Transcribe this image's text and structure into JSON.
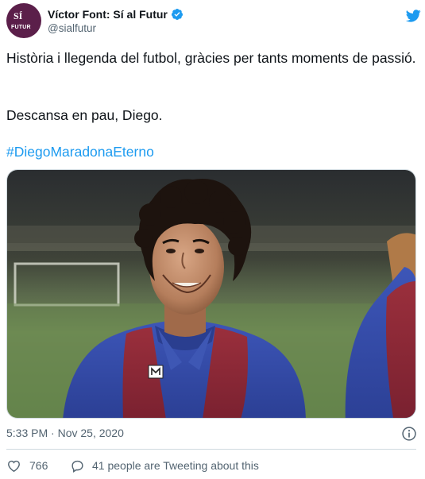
{
  "author": {
    "display_name": "Víctor Font: Sí al Futur",
    "handle": "@sialfutur",
    "avatar_text_top": "SÍ",
    "avatar_text_bottom": "FUTUR",
    "avatar_color": "#5b1f4a",
    "verified": true
  },
  "tweet": {
    "line1": "Història i llegenda del futbol, gràcies per tants moments de passió.",
    "line2": "Descansa en pau, Diego.",
    "hashtag": "#DiegoMaradonaEterno",
    "timestamp": "5:33 PM · Nov 25, 2020",
    "photo_alt": "Photo of Diego Maradona in FC Barcelona kit"
  },
  "engagement": {
    "likes": "766",
    "tweeting": "41 people are Tweeting about this"
  },
  "colors": {
    "accent": "#1d9bf0",
    "text": "#0f1419",
    "secondary": "#536471",
    "border": "#cfd9de"
  },
  "icons": [
    "twitter-bird-icon",
    "verified-badge-icon",
    "info-icon",
    "heart-icon",
    "speech-bubble-icon"
  ]
}
